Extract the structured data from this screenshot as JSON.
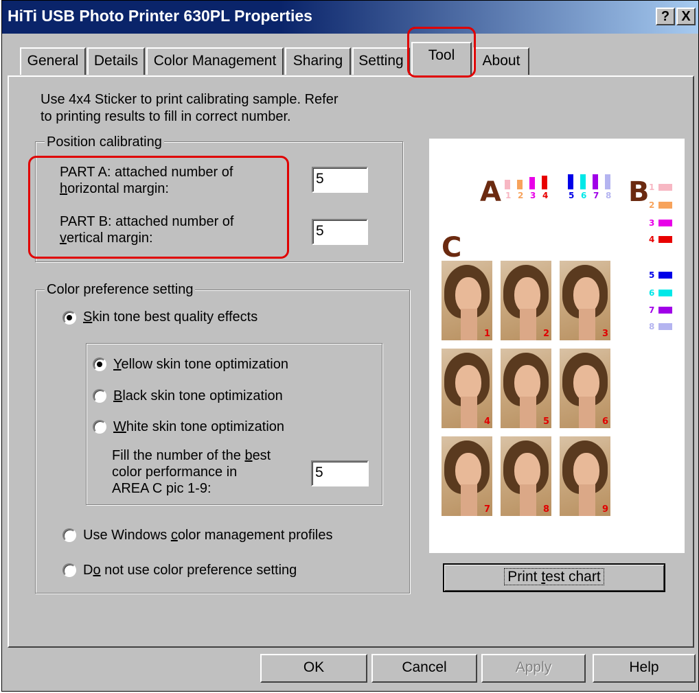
{
  "window": {
    "title": "HiTi USB Photo Printer 630PL Properties",
    "help_btn": "?",
    "close_btn": "X"
  },
  "tabs": [
    {
      "label": "General"
    },
    {
      "label": "Details"
    },
    {
      "label": "Color Management"
    },
    {
      "label": "Sharing"
    },
    {
      "label": "Setting"
    },
    {
      "label": "Tool",
      "active": true
    },
    {
      "label": "About"
    }
  ],
  "intro": {
    "line1": "Use 4x4 Sticker to print calibrating sample.  Refer",
    "line2": "to printing results to fill in correct number."
  },
  "position_group": {
    "label": "Position calibrating",
    "part_a_line1": "PART A: attached number of",
    "part_a_line2_ul": "h",
    "part_a_line2_rest": "orizontal margin:",
    "part_a_value": "5",
    "part_b_line1": "PART B: attached number of",
    "part_b_line2_ul": "v",
    "part_b_line2_rest": "ertical margin:",
    "part_b_value": "5"
  },
  "color_group": {
    "label": "Color preference setting",
    "skin_tone_ul": "S",
    "skin_tone_rest": "kin tone best quality effects",
    "yellow_ul": "Y",
    "yellow_rest": "ellow skin tone optimization",
    "black_ul": "B",
    "black_rest": "lack skin tone optimization",
    "white_ul": "W",
    "white_rest": "hite skin tone optimization",
    "fill_line1_pre": "Fill the number of the ",
    "fill_line1_ul": "b",
    "fill_line1_post": "est",
    "fill_line2": "color performance in",
    "fill_line3": "AREA C pic 1-9:",
    "fill_value": "5",
    "windows_cm_pre": "Use Windows ",
    "windows_cm_ul": "c",
    "windows_cm_post": "olor management profiles",
    "do_not_pre": "D",
    "do_not_ul": "o",
    "do_not_post": " not use color preference setting"
  },
  "preview": {
    "letter_a": "A",
    "letter_b": "B",
    "letter_c": "C",
    "a_nums_left": [
      "1",
      "2",
      "3",
      "4"
    ],
    "a_nums_right": [
      "5",
      "6",
      "7",
      "8"
    ],
    "b_nums": [
      "1",
      "2",
      "3",
      "4",
      "5",
      "6",
      "7",
      "8"
    ],
    "photo_nums": [
      "1",
      "2",
      "3",
      "4",
      "5",
      "6",
      "7",
      "8",
      "9"
    ],
    "colors": {
      "pale_pink": "#f7b7c3",
      "orange": "#f7a35c",
      "magenta": "#e800e8",
      "red": "#e80000",
      "blue": "#0000e8",
      "cyan": "#00e8e8",
      "purple": "#a000e8",
      "lavender": "#b4b4f0"
    }
  },
  "print_test": {
    "pre": "Print ",
    "ul": "t",
    "post": "est chart"
  },
  "buttons": {
    "ok": "OK",
    "cancel": "Cancel",
    "apply": "Apply",
    "help": "Help"
  }
}
